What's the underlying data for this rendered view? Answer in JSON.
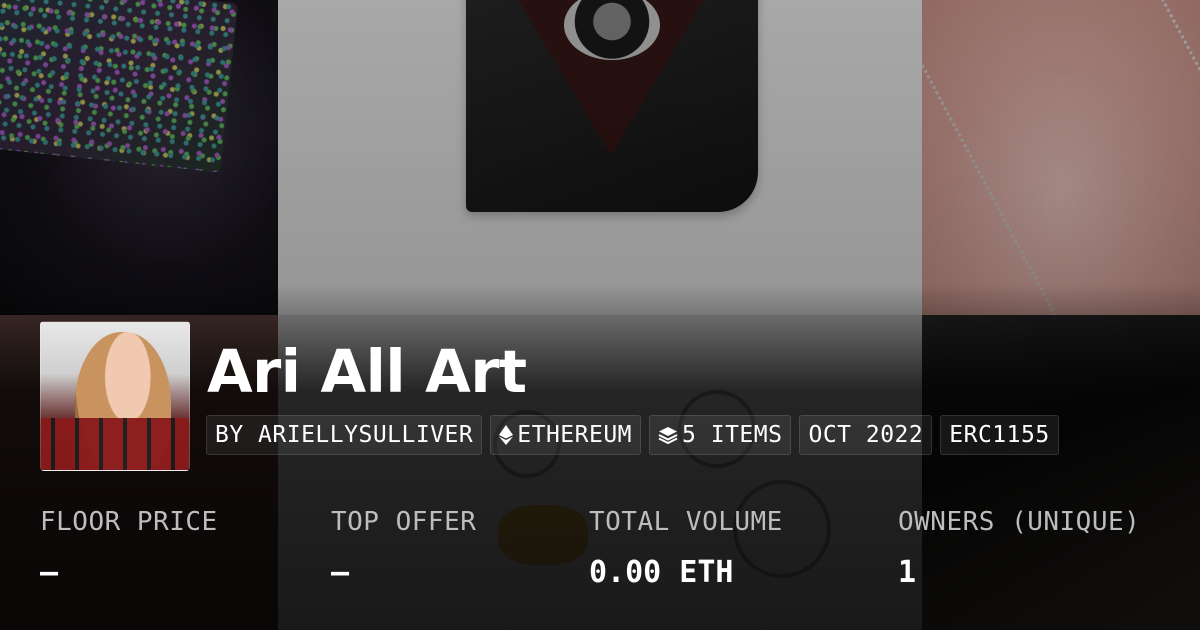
{
  "collection": {
    "title": "Ari All Art",
    "tags": {
      "creator": "BY ARIELLYSULLIVER",
      "chain": "ETHEREUM",
      "items": "5 ITEMS",
      "date": "OCT 2022",
      "standard": "ERC1155"
    }
  },
  "stats": {
    "floor_price": {
      "label": "FLOOR PRICE",
      "value": "–"
    },
    "top_offer": {
      "label": "TOP OFFER",
      "value": "–"
    },
    "total_volume": {
      "label": "TOTAL VOLUME",
      "value": "0.00 ETH"
    },
    "owners": {
      "label": "OWNERS (UNIQUE)",
      "value": "1"
    }
  },
  "icons": {
    "chain_icon": "ethereum-icon",
    "items_icon": "layers-icon"
  }
}
